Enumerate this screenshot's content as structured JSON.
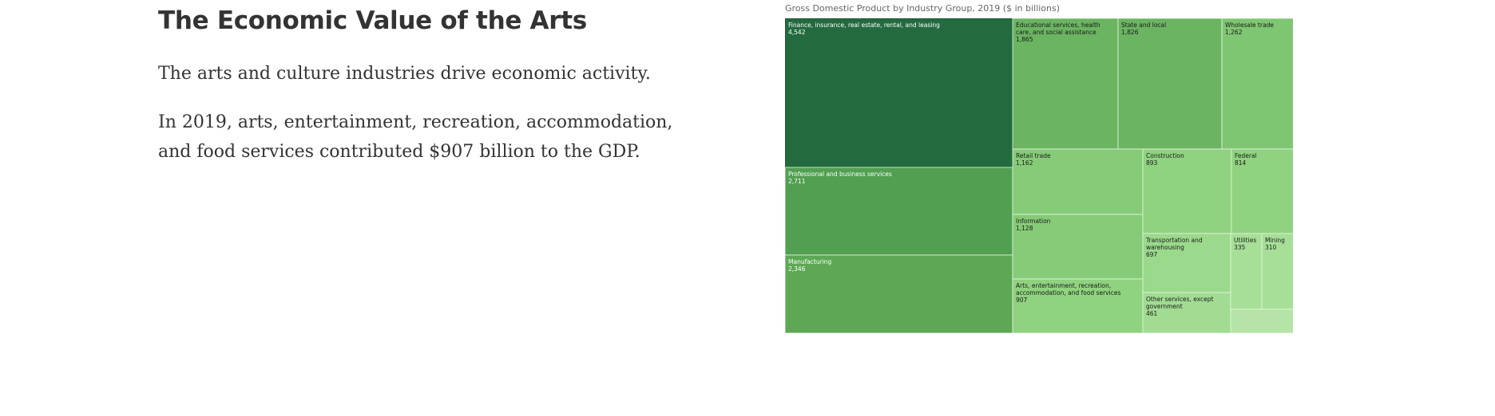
{
  "article": {
    "title": "The Economic Value of the Arts",
    "paragraph1": "The arts and culture industries drive economic activity.",
    "paragraph2": "In 2019, arts, entertainment, recreation, accommodation, and food services contributed $907 billion to the GDP."
  },
  "chart_data": {
    "type": "treemap",
    "title": "Gross Domestic Product by Industry Group, 2019 ($ in billions)",
    "items": [
      {
        "name": "Finance, insurance, real estate, rental, and leasing",
        "value_label": "4,542",
        "value": 4542,
        "color": "#236b3e",
        "text": "#ffffff"
      },
      {
        "name": "Educational services, health care, and social assistance",
        "value_label": "1,865",
        "value": 1865,
        "color": "#6bb462",
        "text": "#1a1a1a"
      },
      {
        "name": "State and local",
        "value_label": "1,826",
        "value": 1826,
        "color": "#6bb462",
        "text": "#1a1a1a"
      },
      {
        "name": "Wholesale trade",
        "value_label": "1,262",
        "value": 1262,
        "color": "#7fc672",
        "text": "#1a1a1a"
      },
      {
        "name": "Professional and business services",
        "value_label": "2,711",
        "value": 2711,
        "color": "#519f51",
        "text": "#ffffff"
      },
      {
        "name": "Manufacturing",
        "value_label": "2,346",
        "value": 2346,
        "color": "#5ea855",
        "text": "#ffffff"
      },
      {
        "name": "Retail trade",
        "value_label": "1,162",
        "value": 1162,
        "color": "#86cb78",
        "text": "#1a1a1a"
      },
      {
        "name": "Information",
        "value_label": "1,128",
        "value": 1128,
        "color": "#86cb78",
        "text": "#1a1a1a"
      },
      {
        "name": "Arts, entertainment, recreation, accommodation, and food services",
        "value_label": "907",
        "value": 907,
        "color": "#8fd27f",
        "text": "#1a1a1a"
      },
      {
        "name": "Construction",
        "value_label": "893",
        "value": 893,
        "color": "#8fd27f",
        "text": "#1a1a1a"
      },
      {
        "name": "Federal",
        "value_label": "814",
        "value": 814,
        "color": "#8fd27f",
        "text": "#1a1a1a"
      },
      {
        "name": "Transportation and warehousing",
        "value_label": "697",
        "value": 697,
        "color": "#9bd98c",
        "text": "#1a1a1a"
      },
      {
        "name": "Other services, except government",
        "value_label": "461",
        "value": 461,
        "color": "#a1dc92",
        "text": "#1a1a1a"
      },
      {
        "name": "Utilities",
        "value_label": "335",
        "value": 335,
        "color": "#a7df98",
        "text": "#1a1a1a"
      },
      {
        "name": "Mining",
        "value_label": "310",
        "value": 310,
        "color": "#a7df98",
        "text": "#1a1a1a"
      },
      {
        "name": "",
        "value_label": "",
        "value": null,
        "color": "#b5e4a6",
        "text": "#1a1a1a"
      }
    ]
  }
}
